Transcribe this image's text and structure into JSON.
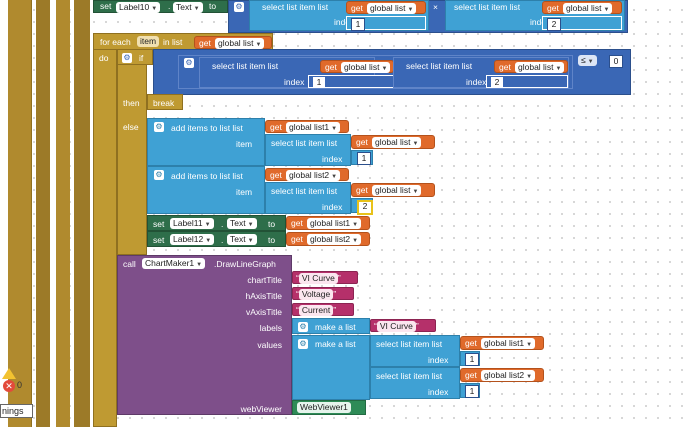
{
  "top_set": {
    "set": "set",
    "component": "Label10",
    "dot": ".",
    "prop": "Text",
    "to": "to",
    "left": {
      "select": "select list item  list",
      "index": "index",
      "get": "get",
      "var": "global list",
      "num": "1"
    },
    "times": "×",
    "right": {
      "select": "select list item  list",
      "index": "index",
      "get": "get",
      "var": "global list",
      "num": "2"
    }
  },
  "for_each": {
    "for_each": "for each",
    "item_var": "item",
    "in_list": "in list",
    "get": "get",
    "var": "global list",
    "do": "do"
  },
  "if_block": {
    "if": "if",
    "then": "then",
    "break": "break",
    "else": "else",
    "left": {
      "select": "select list item  list",
      "index": "index",
      "get": "get",
      "var": "global list",
      "num": "1"
    },
    "times": "×",
    "right": {
      "select": "select list item  list",
      "index": "index",
      "get": "get",
      "var": "global list",
      "num": "2"
    },
    "op": "≤",
    "compare_num": "0"
  },
  "add1": {
    "title": "add items to list  list",
    "get": "get",
    "var": "global list1",
    "item": "item",
    "select": "select list item  list",
    "sel_get": "get",
    "sel_var": "global list",
    "index": "index",
    "num": "1"
  },
  "add2": {
    "title": "add items to list  list",
    "get": "get",
    "var": "global list2",
    "item": "item",
    "select": "select list item  list",
    "sel_get": "get",
    "sel_var": "global list",
    "index": "index",
    "num": "2"
  },
  "set11": {
    "set": "set",
    "component": "Label11",
    "dot": ".",
    "prop": "Text",
    "to": "to",
    "get": "get",
    "var": "global list1"
  },
  "set12": {
    "set": "set",
    "component": "Label12",
    "dot": ".",
    "prop": "Text",
    "to": "to",
    "get": "get",
    "var": "global list2"
  },
  "call": {
    "call": "call",
    "component": "ChartMaker1",
    "method": ".DrawLineGraph",
    "chartTitle": "chartTitle",
    "chartTitle_val": "VI Curve",
    "hAxisTitle": "hAxisTitle",
    "hAxisTitle_val": "Voltage",
    "vAxisTitle": "vAxisTitle",
    "vAxisTitle_val": "Current",
    "labels": "labels",
    "make_list": "make a list",
    "labels_val": "VI Curve",
    "values": "values",
    "make_list2": "make a list",
    "v1_select": "select list item  list",
    "v1_get": "get",
    "v1_var": "global list1",
    "v1_index": "index",
    "v1_num": "1",
    "v2_select": "select list item  list",
    "v2_get": "get",
    "v2_var": "global list2",
    "v2_index": "index",
    "v2_num": "1",
    "webViewer": "webViewer",
    "webViewer_val": "WebViewer1"
  },
  "status": {
    "error_count": "0",
    "warnings_label": "nings"
  }
}
